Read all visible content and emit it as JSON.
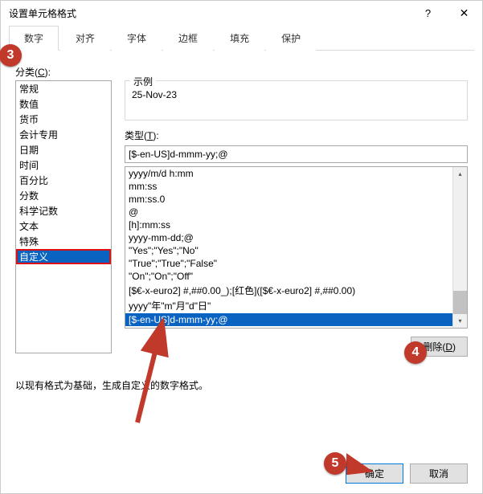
{
  "title": "设置单元格格式",
  "tabs": [
    "数字",
    "对齐",
    "字体",
    "边框",
    "填充",
    "保护"
  ],
  "active_tab_index": 0,
  "category_label": "分类(C):",
  "category_hotkey": "C",
  "categories": [
    "常规",
    "数值",
    "货币",
    "会计专用",
    "日期",
    "时间",
    "百分比",
    "分数",
    "科学记数",
    "文本",
    "特殊",
    "自定义"
  ],
  "selected_category_index": 11,
  "sample_label": "示例",
  "sample_value": "25-Nov-23",
  "type_label": "类型(T):",
  "type_value": "[$-en-US]d-mmm-yy;@",
  "type_options": [
    "yyyy/m/d h:mm",
    "mm:ss",
    "mm:ss.0",
    "@",
    "[h]:mm:ss",
    "yyyy-mm-dd;@",
    "\"Yes\";\"Yes\";\"No\"",
    "\"True\";\"True\";\"False\"",
    "\"On\";\"On\";\"Off\"",
    "[$€-x-euro2] #,##0.00_);[红色]([$€-x-euro2] #,##0.00)",
    "yyyy\"年\"m\"月\"d\"日\"",
    "[$-en-US]d-mmm-yy;@"
  ],
  "selected_type_index": 11,
  "delete_label": "删除(D)",
  "hint_text": "以现有格式为基础，生成自定义的数字格式。",
  "ok_label": "确定",
  "cancel_label": "取消",
  "annotations": {
    "a3": "3",
    "a4": "4",
    "a5": "5"
  }
}
